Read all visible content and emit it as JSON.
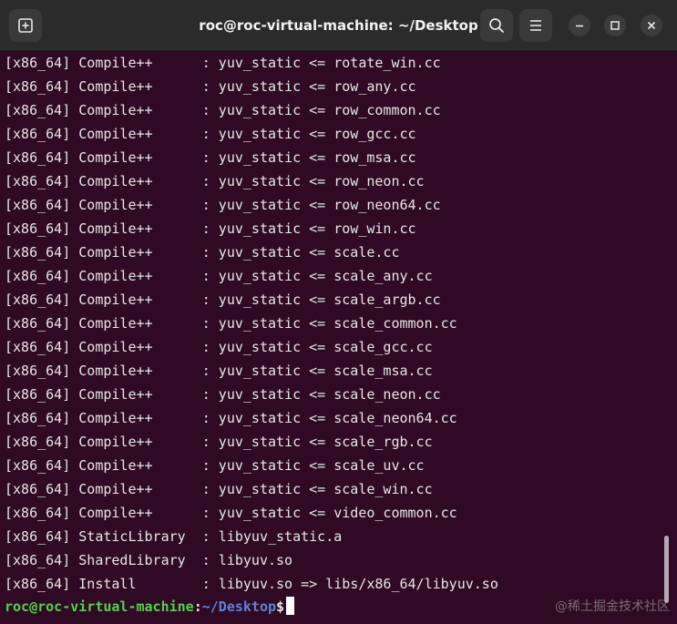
{
  "window": {
    "title": "roc@roc-virtual-machine: ~/Desktop"
  },
  "icons": {
    "new_tab": "new-tab-icon",
    "search": "search-icon",
    "menu": "hamburger-menu-icon",
    "minimize": "minimize-icon",
    "maximize": "maximize-icon",
    "close": "close-icon"
  },
  "terminal": {
    "lines": [
      "[x86_64] Compile++      : yuv_static <= rotate_win.cc",
      "[x86_64] Compile++      : yuv_static <= row_any.cc",
      "[x86_64] Compile++      : yuv_static <= row_common.cc",
      "[x86_64] Compile++      : yuv_static <= row_gcc.cc",
      "[x86_64] Compile++      : yuv_static <= row_msa.cc",
      "[x86_64] Compile++      : yuv_static <= row_neon.cc",
      "[x86_64] Compile++      : yuv_static <= row_neon64.cc",
      "[x86_64] Compile++      : yuv_static <= row_win.cc",
      "[x86_64] Compile++      : yuv_static <= scale.cc",
      "[x86_64] Compile++      : yuv_static <= scale_any.cc",
      "[x86_64] Compile++      : yuv_static <= scale_argb.cc",
      "[x86_64] Compile++      : yuv_static <= scale_common.cc",
      "[x86_64] Compile++      : yuv_static <= scale_gcc.cc",
      "[x86_64] Compile++      : yuv_static <= scale_msa.cc",
      "[x86_64] Compile++      : yuv_static <= scale_neon.cc",
      "[x86_64] Compile++      : yuv_static <= scale_neon64.cc",
      "[x86_64] Compile++      : yuv_static <= scale_rgb.cc",
      "[x86_64] Compile++      : yuv_static <= scale_uv.cc",
      "[x86_64] Compile++      : yuv_static <= scale_win.cc",
      "[x86_64] Compile++      : yuv_static <= video_common.cc",
      "[x86_64] StaticLibrary  : libyuv_static.a",
      "[x86_64] SharedLibrary  : libyuv.so",
      "[x86_64] Install        : libyuv.so => libs/x86_64/libyuv.so"
    ],
    "prompt": {
      "user_host": "roc@roc-virtual-machine",
      "separator": ":",
      "path": "~/Desktop",
      "symbol": "$"
    }
  },
  "watermark": "@稀土掘金技术社区",
  "colors": {
    "terminal_bg": "#300a24",
    "titlebar_bg": "#2b2b2b",
    "prompt_user": "#4fd34a",
    "prompt_path": "#5c84d6"
  }
}
